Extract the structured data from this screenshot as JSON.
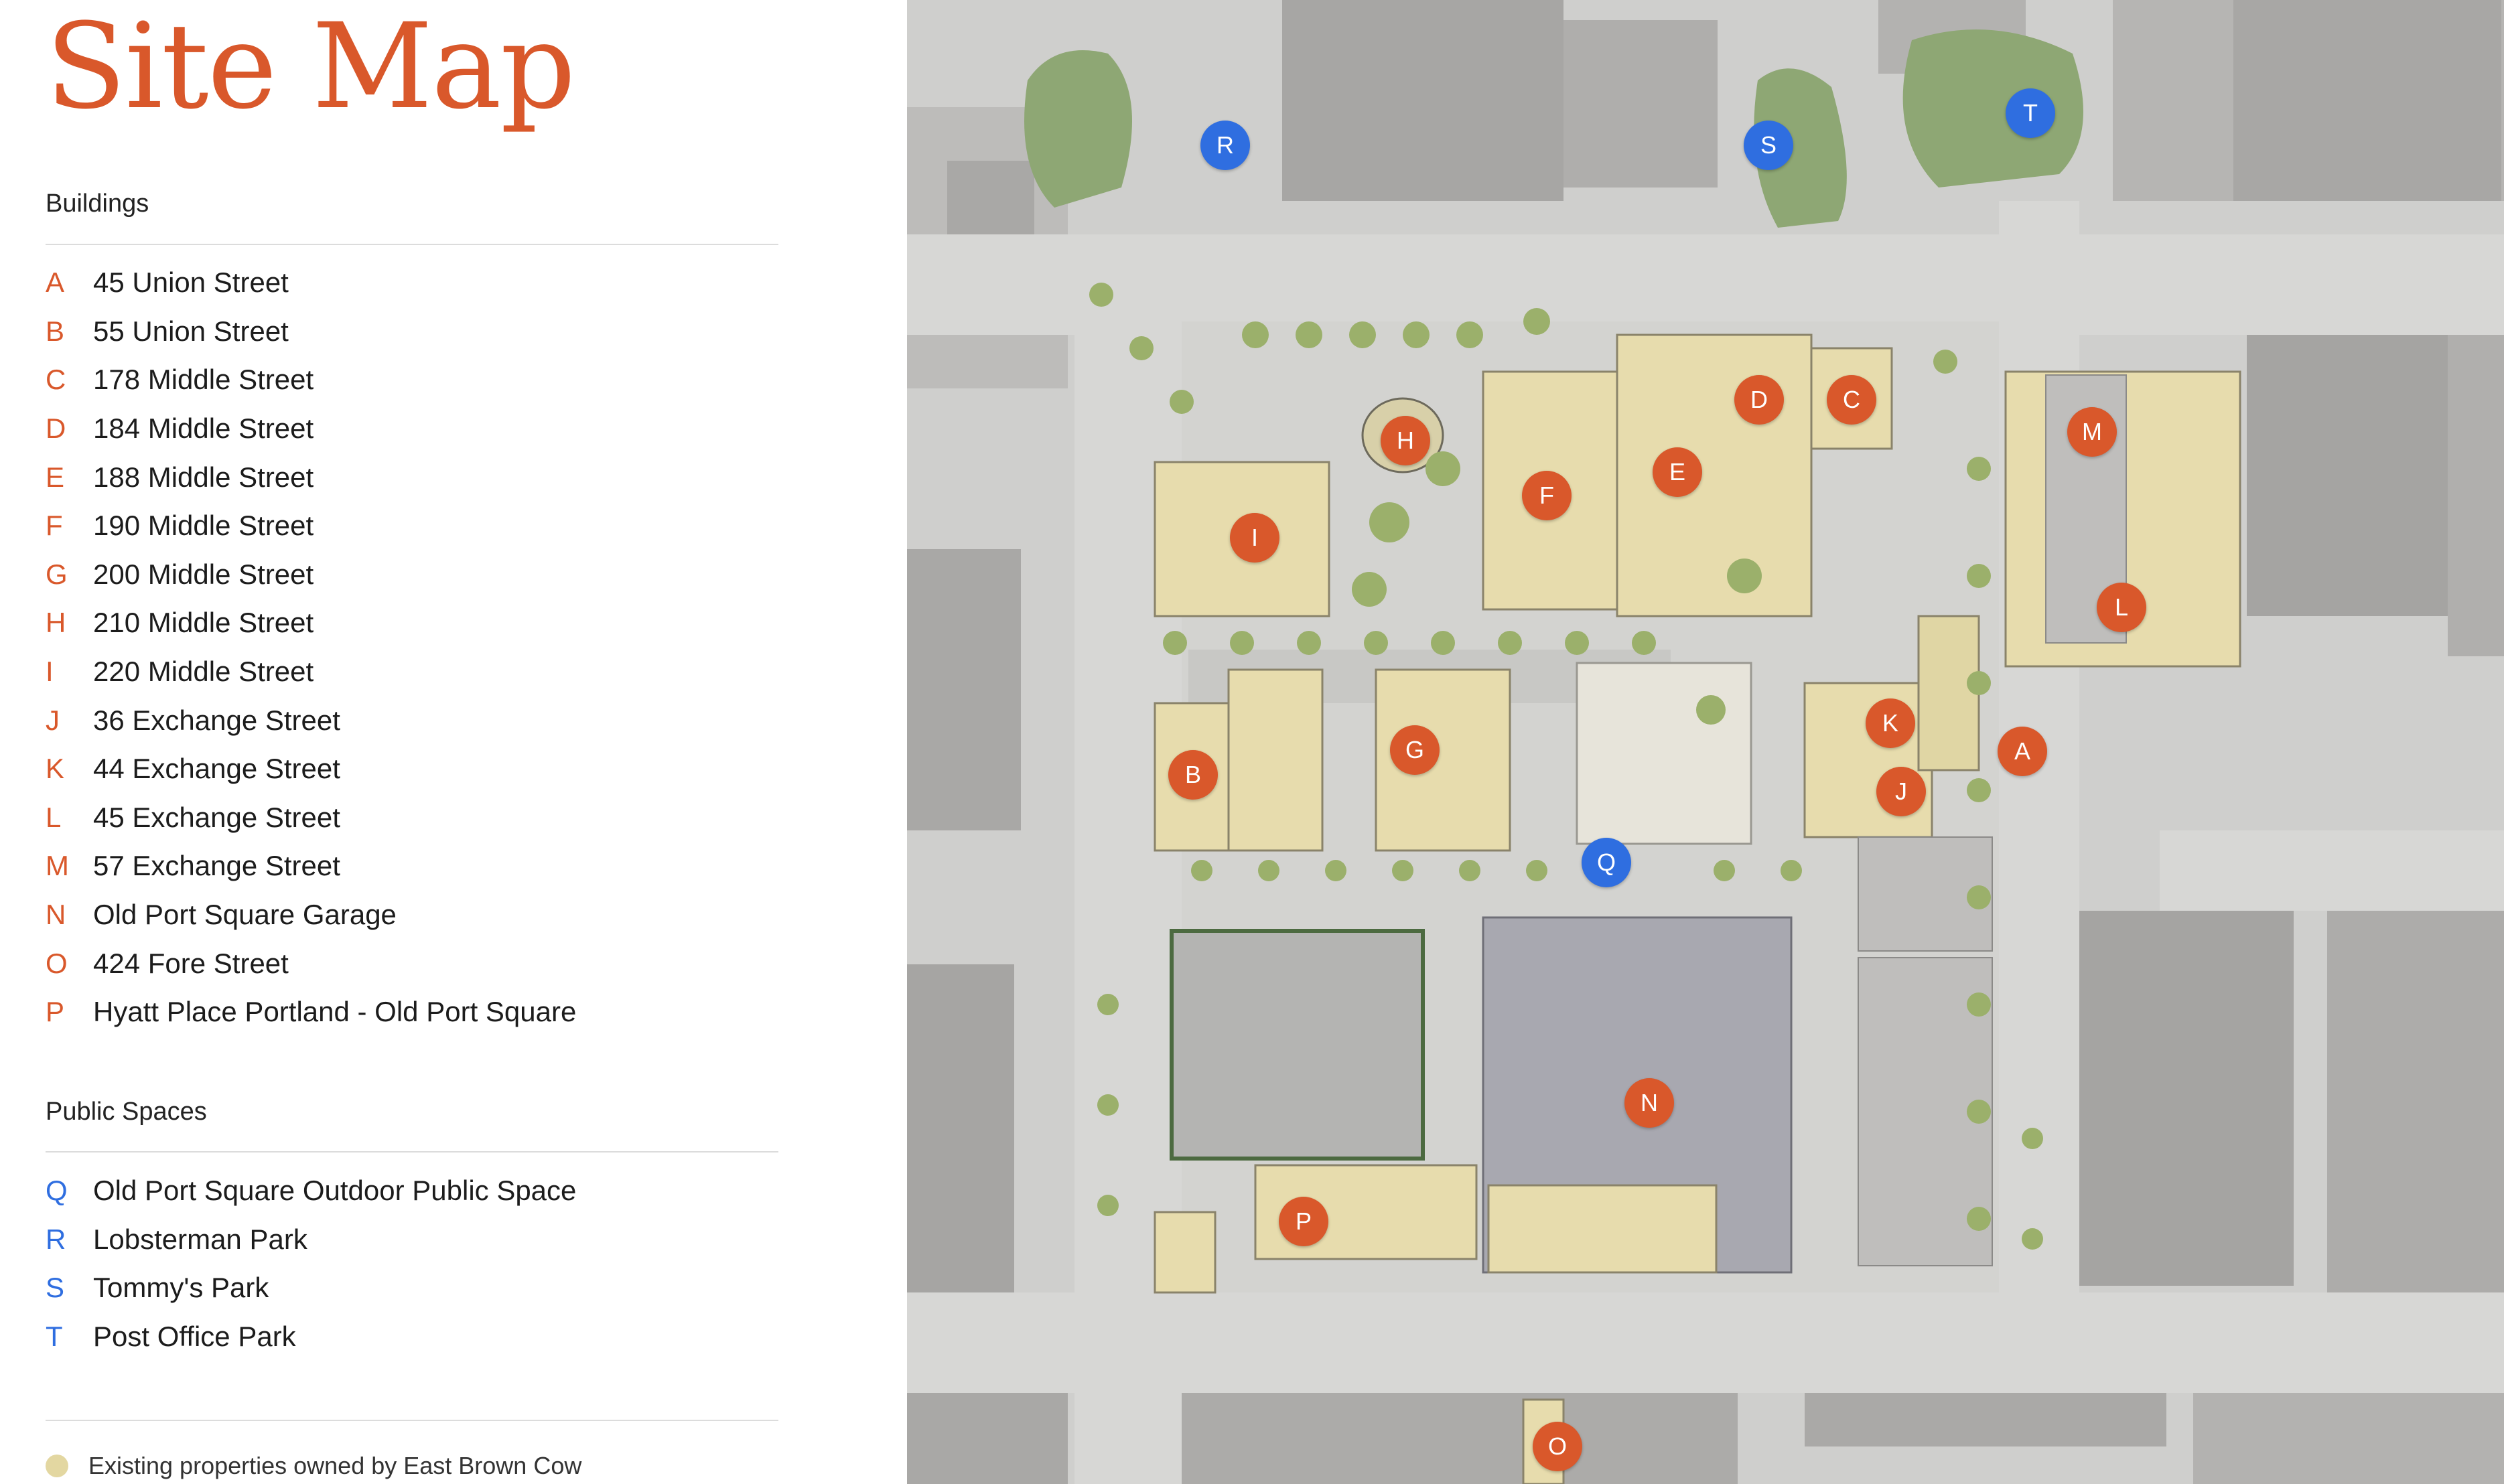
{
  "title": "Site Map",
  "colors": {
    "accent_orange": "#d9582b",
    "accent_blue": "#2f6ee0",
    "owned_property": "#e3d7a1"
  },
  "buildings": {
    "heading": "Buildings",
    "items": [
      {
        "letter": "A",
        "name": "45 Union Street"
      },
      {
        "letter": "B",
        "name": "55 Union Street"
      },
      {
        "letter": "C",
        "name": "178 Middle Street"
      },
      {
        "letter": "D",
        "name": "184 Middle Street"
      },
      {
        "letter": "E",
        "name": "188 Middle Street"
      },
      {
        "letter": "F",
        "name": "190 Middle Street"
      },
      {
        "letter": "G",
        "name": "200 Middle Street"
      },
      {
        "letter": "H",
        "name": "210 Middle Street"
      },
      {
        "letter": "I",
        "name": "220 Middle Street"
      },
      {
        "letter": "J",
        "name": "36 Exchange Street"
      },
      {
        "letter": "K",
        "name": "44 Exchange Street"
      },
      {
        "letter": "L",
        "name": "45 Exchange Street"
      },
      {
        "letter": "M",
        "name": "57 Exchange Street"
      },
      {
        "letter": "N",
        "name": "Old Port Square Garage"
      },
      {
        "letter": "O",
        "name": "424 Fore Street"
      },
      {
        "letter": "P",
        "name": "Hyatt Place Portland - Old Port Square"
      }
    ]
  },
  "public_spaces": {
    "heading": "Public Spaces",
    "items": [
      {
        "letter": "Q",
        "name": "Old Port Square Outdoor Public Space"
      },
      {
        "letter": "R",
        "name": "Lobsterman Park"
      },
      {
        "letter": "S",
        "name": "Tommy's Park"
      },
      {
        "letter": "T",
        "name": "Post Office Park"
      }
    ]
  },
  "legend_key": {
    "label": "Existing properties owned by East Brown Cow"
  },
  "map_markers": [
    "A",
    "B",
    "C",
    "D",
    "E",
    "F",
    "G",
    "H",
    "I",
    "J",
    "K",
    "L",
    "M",
    "N",
    "O",
    "P",
    "Q",
    "R",
    "S",
    "T"
  ]
}
